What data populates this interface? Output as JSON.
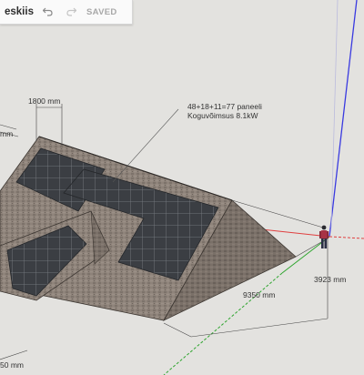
{
  "toolbar": {
    "title": "eskiis",
    "undo_icon": "undo-icon",
    "redo_icon": "redo-icon",
    "status": "SAVED"
  },
  "annotation": {
    "line1": "48+18+11=77 paneeli",
    "line2": "Koguvõimsus 8.1kW"
  },
  "dimensions": {
    "top": "1800 mm",
    "left_top": "mm",
    "length": "9350 mm",
    "height": "3923 mm",
    "bottom_left": "50 mm"
  },
  "colors": {
    "background": "#e3e2df",
    "roof": "#8c8178",
    "panel": "#3a3d42",
    "axis_red": "#e04040",
    "axis_green": "#2fa52f",
    "axis_blue": "#3a3ae0"
  }
}
